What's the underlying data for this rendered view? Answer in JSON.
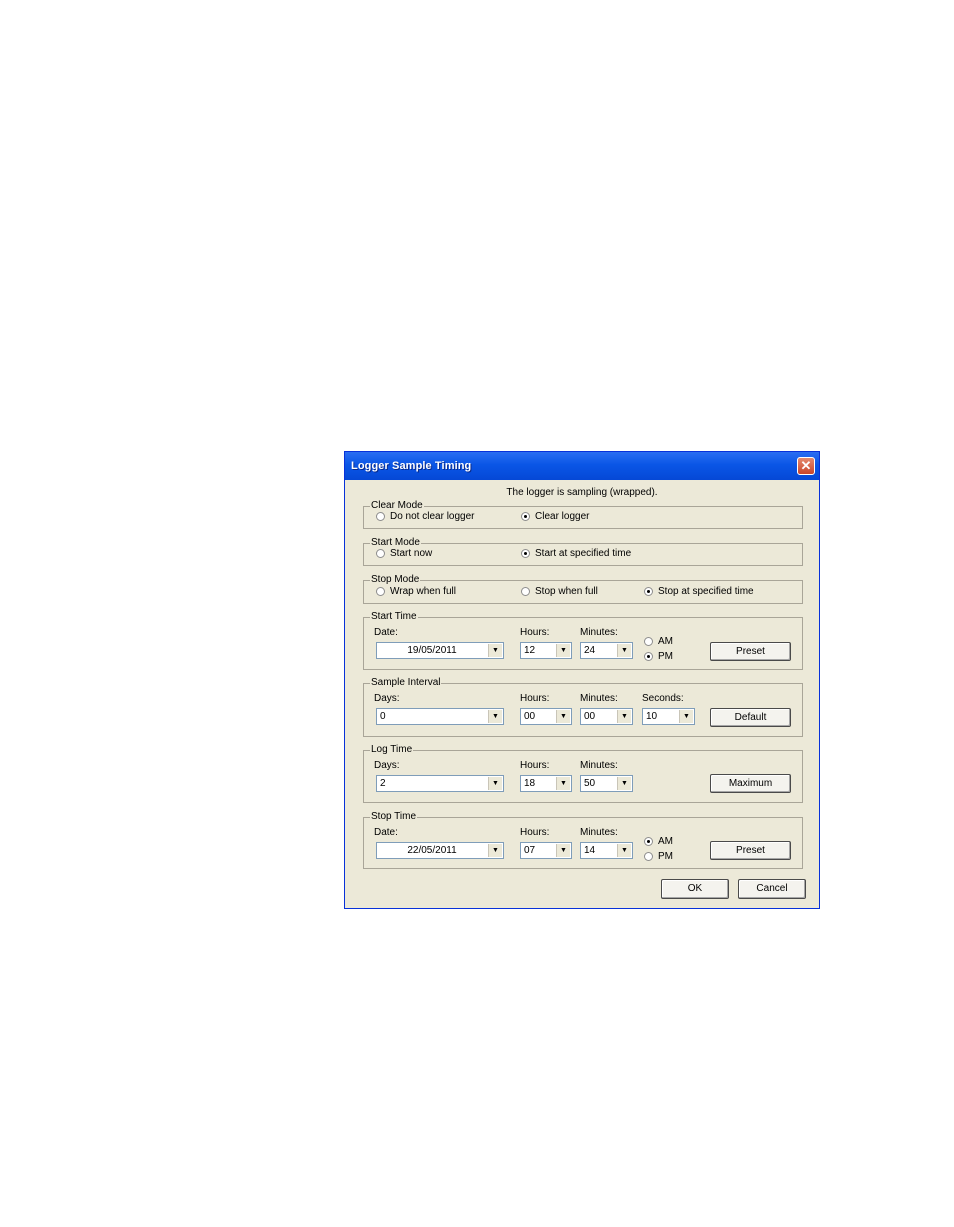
{
  "window": {
    "title": "Logger Sample Timing",
    "close": "✕"
  },
  "status": "The logger is sampling (wrapped).",
  "clear_mode": {
    "legend": "Clear Mode",
    "options": [
      "Do not clear logger",
      "Clear logger"
    ],
    "selected": 1
  },
  "start_mode": {
    "legend": "Start Mode",
    "options": [
      "Start now",
      "Start at specified time"
    ],
    "selected": 1
  },
  "stop_mode": {
    "legend": "Stop Mode",
    "options": [
      "Wrap when full",
      "Stop when full",
      "Stop at specified time"
    ],
    "selected": 2
  },
  "start_time": {
    "legend": "Start Time",
    "date_label": "Date:",
    "date": "19/05/2011",
    "hours_label": "Hours:",
    "hours": "12",
    "minutes_label": "Minutes:",
    "minutes": "24",
    "am": "AM",
    "pm": "PM",
    "ampm_selected": "PM",
    "button": "Preset"
  },
  "sample_interval": {
    "legend": "Sample Interval",
    "days_label": "Days:",
    "days": "0",
    "hours_label": "Hours:",
    "hours": "00",
    "minutes_label": "Minutes:",
    "minutes": "00",
    "seconds_label": "Seconds:",
    "seconds": "10",
    "button": "Default"
  },
  "log_time": {
    "legend": "Log Time",
    "days_label": "Days:",
    "days": "2",
    "hours_label": "Hours:",
    "hours": "18",
    "minutes_label": "Minutes:",
    "minutes": "50",
    "button": "Maximum"
  },
  "stop_time": {
    "legend": "Stop Time",
    "date_label": "Date:",
    "date": "22/05/2011",
    "hours_label": "Hours:",
    "hours": "07",
    "minutes_label": "Minutes:",
    "minutes": "14",
    "am": "AM",
    "pm": "PM",
    "ampm_selected": "AM",
    "button": "Preset"
  },
  "footer": {
    "ok": "OK",
    "cancel": "Cancel"
  },
  "icons": {
    "dropdown": "▼"
  }
}
